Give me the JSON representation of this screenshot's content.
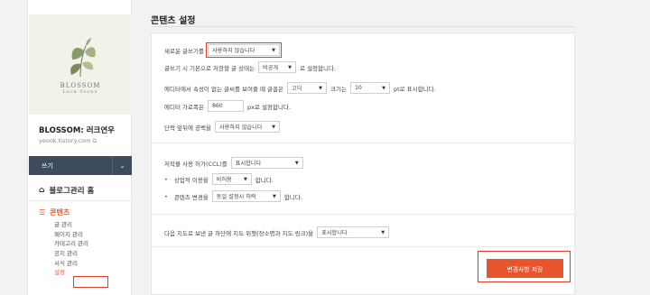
{
  "sidebar": {
    "logo_text": "BLOSSOM",
    "logo_sub": "Luck·Yeonu",
    "blog_title": "BLOSSOM: 러크연우",
    "blog_url": "yeook.tistory.com",
    "write_label": "쓰기",
    "home_label": "블로그관리 홈",
    "content_label": "콘텐츠",
    "submenu": [
      "글 관리",
      "페이지 관리",
      "카테고리 관리",
      "공지 관리",
      "서식 관리",
      "설정"
    ]
  },
  "page_title": "콘텐츠 설정",
  "settings": {
    "new_post_label": "새로운 글쓰기를",
    "new_post_value": "사용하지 않습니다",
    "save_state_prefix": "글쓰기 시 기본으로 저장할 글 상태는",
    "save_state_value": "비공개",
    "save_state_suffix": "로 설정합니다.",
    "font_prefix": "에디터에서 속성이 없는 글씨를 보여줄 때 글꼴은",
    "font_value": "고딕",
    "font_size_mid": "크기는",
    "font_size_value": "10",
    "font_size_suffix": "pt로 표시합니다.",
    "width_prefix": "에디터 가로폭은",
    "width_value": "860",
    "width_suffix": "px로 설정합니다.",
    "para_prefix": "단락 앞뒤에 공백을",
    "para_value": "사용하지 않습니다",
    "ccl_prefix": "저작물 사용 허가(CCL)를",
    "ccl_value": "표시합니다",
    "commercial_prefix": "상업적 이용을",
    "commercial_value": "비허용",
    "commercial_suffix": "합니다.",
    "modify_prefix": "콘텐츠 변경을",
    "modify_value": "동일 설정시 허락",
    "modify_suffix": "합니다.",
    "map_prefix": "다음 지도로 보낸 글 하단에 지도 위젯(장소명과 지도 링크)을",
    "map_value": "표시합니다"
  },
  "save_button": "변경사항 저장"
}
